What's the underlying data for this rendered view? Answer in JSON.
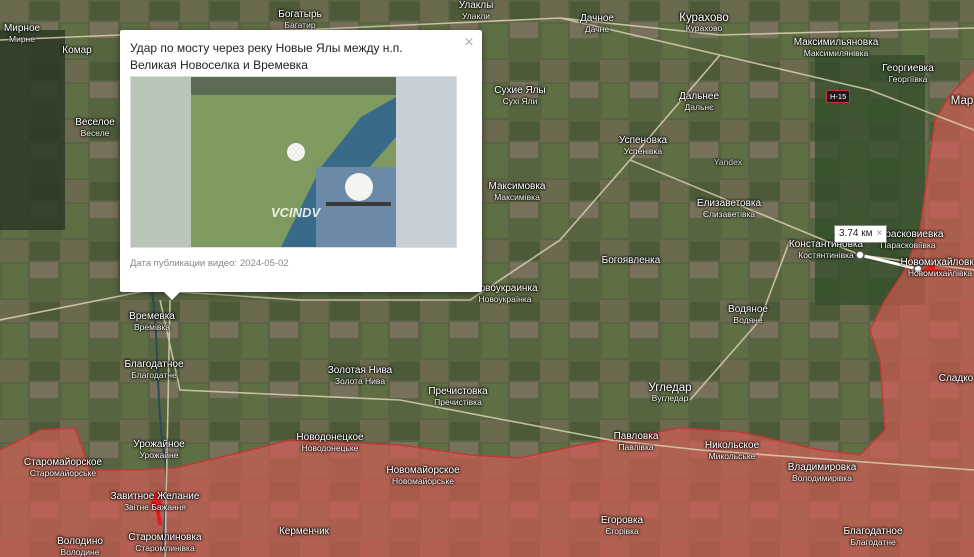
{
  "popup": {
    "title": "Удар по мосту через реку Новые Ялы между н.п. Великая Новоселка и Времевка",
    "date_label": "Дата публикации видео:",
    "date_value": "2024-05-02",
    "close_glyph": "×",
    "watermark": "VCINDV"
  },
  "measure": {
    "distance": "3.74 км",
    "close_glyph": "×"
  },
  "road_sign": "H-15",
  "map_provider": "Yandex",
  "places": {
    "kurakhovo": [
      "Курахово",
      "Курахово"
    ],
    "dachnoe": [
      "Дачное",
      "Дачне"
    ],
    "ulakly": [
      "Улаклы",
      "Улакли"
    ],
    "bogatyr": [
      "Богатырь",
      "Багатир"
    ],
    "mirnoe": [
      "Мирное",
      "Мирне"
    ],
    "komar": [
      "Комар",
      ""
    ],
    "veseloe": [
      "Веселое",
      "Веселе"
    ],
    "sukhie_yaly": [
      "Сухие Ялы",
      "Сухі Яли"
    ],
    "dalnee": [
      "Дальнее",
      "Дальнє"
    ],
    "uspenovka": [
      "Успеновка",
      "Успенівка"
    ],
    "maksimilyanovka": [
      "Максимильяновка",
      "Максимилянівка"
    ],
    "georgievka": [
      "Георгиевка",
      "Георгіївка"
    ],
    "mar": [
      "Мар",
      ""
    ],
    "maksimovka": [
      "Максимовка",
      "Максимівка"
    ],
    "elizavetovka": [
      "Елизаветовка",
      "Єлизаветівка"
    ],
    "konstantinovka": [
      "Константиновка",
      "Костянтинівка"
    ],
    "paraskoveevka": [
      "Парасковиевка",
      "Парасковіївка"
    ],
    "novomikhaylovka": [
      "Новомихайловка",
      "Новомихайлівка"
    ],
    "novoukrainka": [
      "Новоукраинка",
      "Новоукраїнка"
    ],
    "bogoyavlenka": [
      "Богоявленка",
      ""
    ],
    "vremevka": [
      "Времевка",
      "Времівка"
    ],
    "vodyanoe": [
      "Водяное",
      "Водяне"
    ],
    "blagodatnoe": [
      "Благодатное",
      "Благодатне"
    ],
    "zolotaya_niva": [
      "Золотая Нива",
      "Золота Нива"
    ],
    "prechistovka": [
      "Пречистовка",
      "Пречистівка"
    ],
    "ugledar": [
      "Угледар",
      "Вугледар"
    ],
    "urozhaynoe": [
      "Урожайное",
      "Урожайне"
    ],
    "novodonetskoe": [
      "Новодонецкое",
      "Новодонецьке"
    ],
    "pavlovka": [
      "Павловка",
      "Павлівка"
    ],
    "nikolskoe": [
      "Никольское",
      "Микольське"
    ],
    "staromayorskoe": [
      "Старомайорское",
      "Старомайорське"
    ],
    "novomayorskoe": [
      "Новомайорское",
      "Новомайорське"
    ],
    "vladimirovka": [
      "Владимировка",
      "Володимирівка"
    ],
    "zavitnoe_zhelanie": [
      "Завитное Желание",
      "Звітне Бажання"
    ],
    "kermenchik": [
      "Керменчик",
      ""
    ],
    "egorovka": [
      "Егоровка",
      "Єгорівка"
    ],
    "volodino": [
      "Володино",
      "Володине"
    ],
    "staromlinovka": [
      "Старомлиновка",
      "Старомлинівка"
    ],
    "blagodatnoe_east": [
      "Благодатное",
      "Благодатне"
    ],
    "sladkoe": [
      "Сладко",
      ""
    ]
  }
}
